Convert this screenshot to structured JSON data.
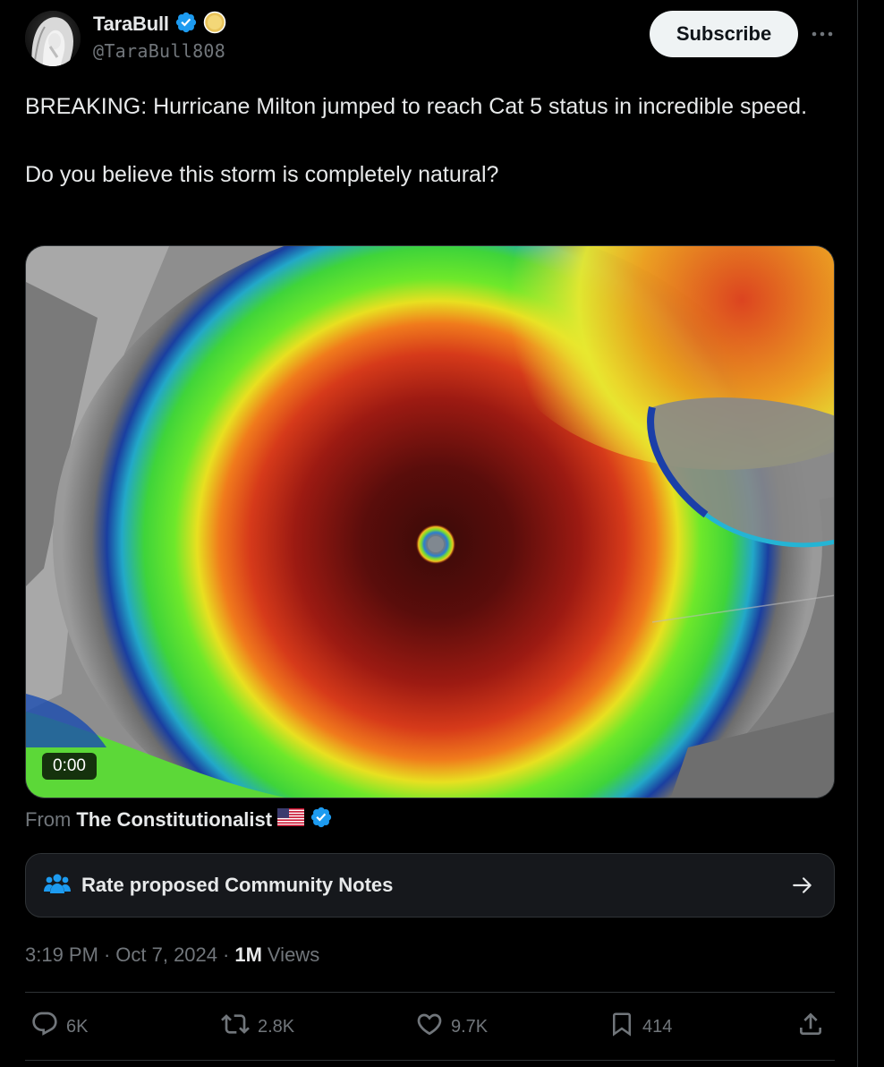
{
  "author": {
    "display_name": "TaraBull",
    "handle": "@TaraBull808",
    "verified_color": "#1d9bf0",
    "badge_color": "#e8c35a"
  },
  "header": {
    "subscribe_label": "Subscribe",
    "more_icon": "more-horizontal-icon"
  },
  "tweet": {
    "line1": "BREAKING: Hurricane Milton jumped to reach Cat 5 status in incredible speed.",
    "line2": "Do you believe this storm is completely natural?"
  },
  "media": {
    "timestamp": "0:00"
  },
  "source": {
    "from_label": "From",
    "name": "The Constitutionalist",
    "flag_icon": "us-flag-icon"
  },
  "community_notes": {
    "label": "Rate proposed Community Notes",
    "icon": "people-icon",
    "arrow_icon": "arrow-right-icon"
  },
  "meta": {
    "time": "3:19 PM",
    "sep1": "·",
    "date": "Oct 7, 2024",
    "sep2": "·",
    "views_count": "1M",
    "views_label": "Views"
  },
  "actions": {
    "replies": "6K",
    "reposts": "2.8K",
    "likes": "9.7K",
    "bookmarks": "414"
  },
  "colors": {
    "background": "#000000",
    "text": "#e7e9ea",
    "muted": "#71767b",
    "accent": "#1d9bf0"
  }
}
